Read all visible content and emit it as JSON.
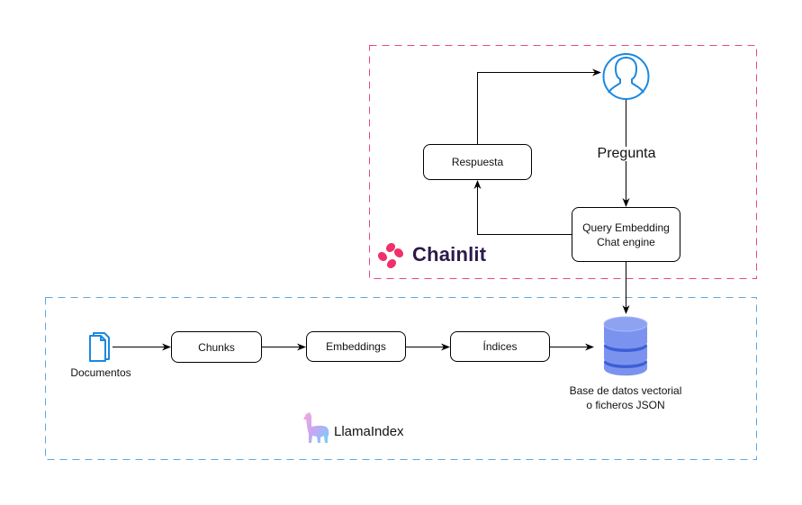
{
  "groups": {
    "chainlit": {
      "brand": "Chainlit",
      "border_color": "#e8458f"
    },
    "llamaindex": {
      "brand": "LlamaIndex",
      "border_color": "#5aa7e8"
    }
  },
  "nodes": {
    "respuesta": "Respuesta",
    "query_engine": "Query Embedding\nChat engine",
    "chunks": "Chunks",
    "embeddings": "Embeddings",
    "indices": "Índices"
  },
  "labels": {
    "user_icon": "user-icon",
    "pregunta": "Pregunta",
    "documentos": "Documentos",
    "database": "Base de datos vectorial\no ficheros JSON"
  },
  "colors": {
    "user_icon": "#1a88e0",
    "document_icon": "#1a88e0",
    "database_light": "#7b93ee",
    "database_dark": "#3c5fd6",
    "chainlit_logo": "#f0306a",
    "chainlit_text": "#2b1a4a"
  }
}
